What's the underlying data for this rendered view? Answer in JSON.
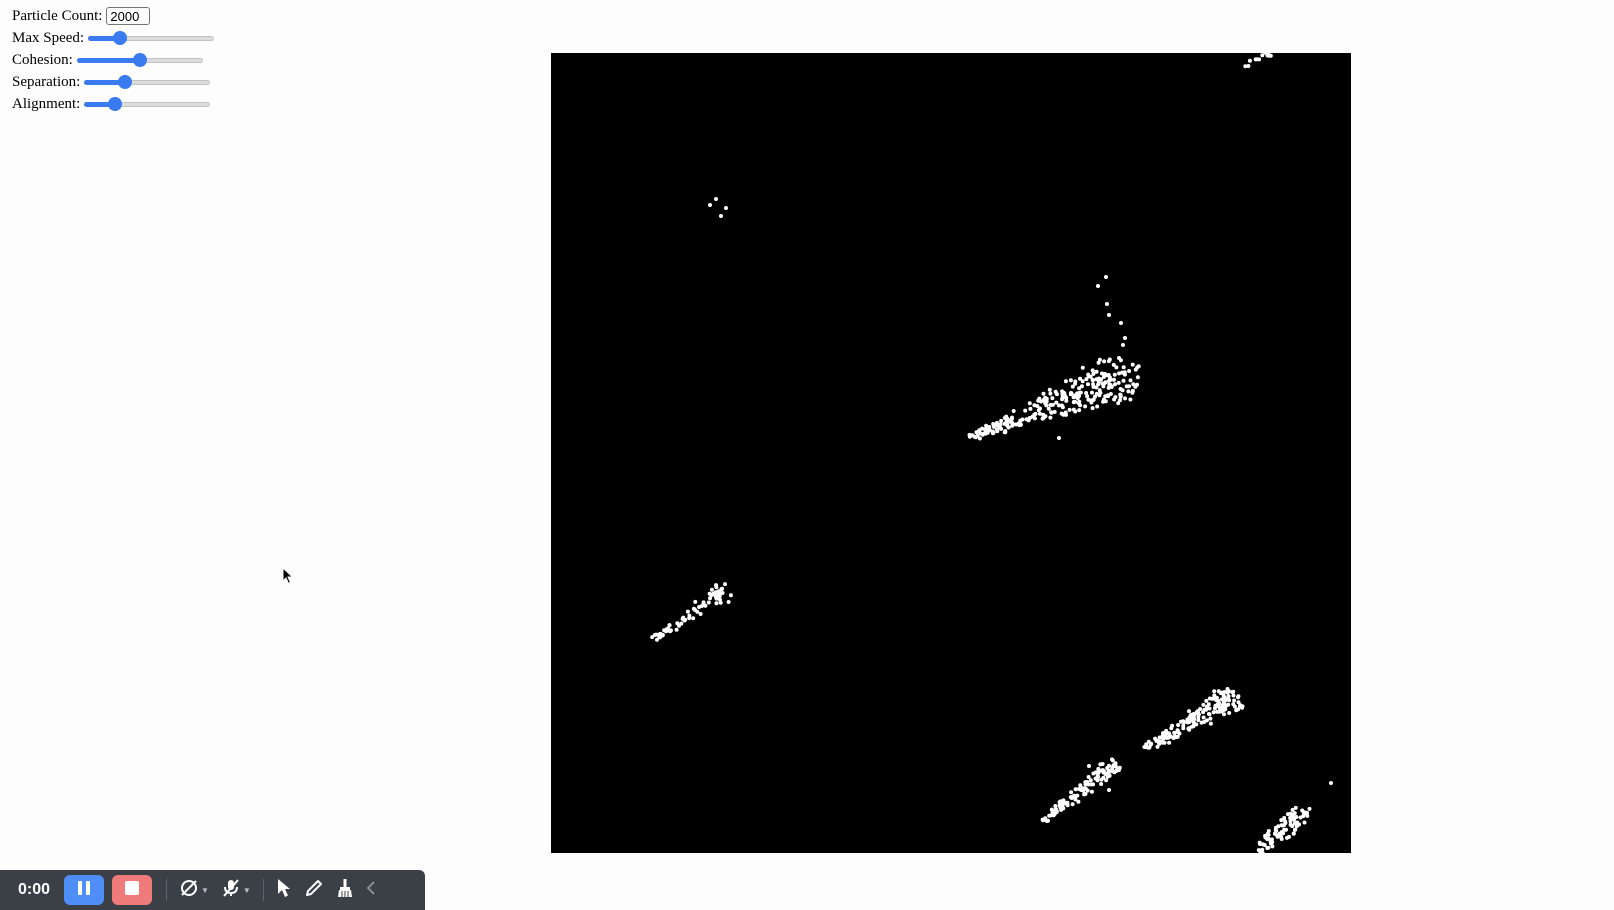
{
  "controls": {
    "particle_count_label": "Particle Count:",
    "particle_count_value": "2000",
    "sliders": [
      {
        "label": "Max Speed:",
        "value_fraction": 0.25
      },
      {
        "label": "Cohesion:",
        "value_fraction": 0.5
      },
      {
        "label": "Separation:",
        "value_fraction": 0.32
      },
      {
        "label": "Alignment:",
        "value_fraction": 0.24
      }
    ]
  },
  "simulation": {
    "background": "#000000",
    "particle_color": "#ffffff"
  },
  "recorder": {
    "time": "0:00",
    "pause_color": "#4f8ef7",
    "stop_color": "#f07b7b",
    "icons": [
      "pause-icon",
      "stop-icon",
      "camera-off-icon",
      "microphone-off-icon",
      "pointer-icon",
      "pen-icon",
      "broom-icon",
      "chevron-left-icon"
    ]
  },
  "accent_color": "#3a7bf0"
}
